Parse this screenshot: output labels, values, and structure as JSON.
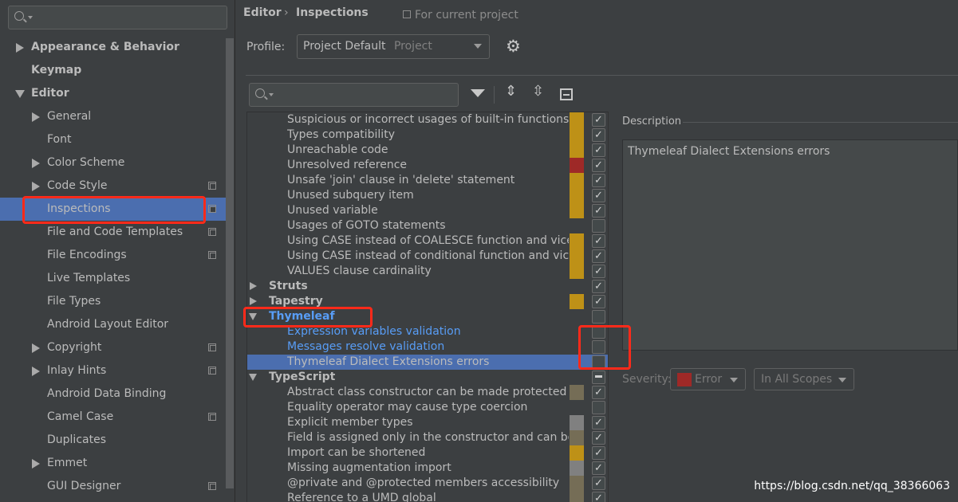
{
  "sidebar": {
    "search_placeholder": "",
    "items": [
      {
        "label": "Appearance & Behavior",
        "level": 0,
        "expander": "collapsed",
        "copy_icon": false
      },
      {
        "label": "Keymap",
        "level": 0,
        "expander": "none",
        "copy_icon": false
      },
      {
        "label": "Editor",
        "level": 0,
        "expander": "expanded",
        "copy_icon": false
      },
      {
        "label": "General",
        "level": 1,
        "expander": "collapsed",
        "copy_icon": false
      },
      {
        "label": "Font",
        "level": 1,
        "expander": "none",
        "copy_icon": false
      },
      {
        "label": "Color Scheme",
        "level": 1,
        "expander": "collapsed",
        "copy_icon": false
      },
      {
        "label": "Code Style",
        "level": 1,
        "expander": "collapsed",
        "copy_icon": true
      },
      {
        "label": "Inspections",
        "level": 1,
        "expander": "none",
        "copy_icon": true,
        "selected": true
      },
      {
        "label": "File and Code Templates",
        "level": 1,
        "expander": "none",
        "copy_icon": true
      },
      {
        "label": "File Encodings",
        "level": 1,
        "expander": "none",
        "copy_icon": true
      },
      {
        "label": "Live Templates",
        "level": 1,
        "expander": "none",
        "copy_icon": false
      },
      {
        "label": "File Types",
        "level": 1,
        "expander": "none",
        "copy_icon": false
      },
      {
        "label": "Android Layout Editor",
        "level": 1,
        "expander": "none",
        "copy_icon": false
      },
      {
        "label": "Copyright",
        "level": 1,
        "expander": "collapsed",
        "copy_icon": true
      },
      {
        "label": "Inlay Hints",
        "level": 1,
        "expander": "collapsed",
        "copy_icon": true
      },
      {
        "label": "Android Data Binding",
        "level": 1,
        "expander": "none",
        "copy_icon": false
      },
      {
        "label": "Camel Case",
        "level": 1,
        "expander": "none",
        "copy_icon": true
      },
      {
        "label": "Duplicates",
        "level": 1,
        "expander": "none",
        "copy_icon": false
      },
      {
        "label": "Emmet",
        "level": 1,
        "expander": "collapsed",
        "copy_icon": false
      },
      {
        "label": "GUI Designer",
        "level": 1,
        "expander": "none",
        "copy_icon": true
      }
    ]
  },
  "header": {
    "breadcrumb": [
      "Editor",
      "Inspections"
    ],
    "breadcrumb_separator": "›",
    "scope_note": "For current project",
    "profile_label": "Profile:",
    "profile_value": "Project Default",
    "profile_type": "Project"
  },
  "colors": {
    "warning": "#be9117",
    "error": "#9e2927",
    "weak_warning": "#756d56",
    "info": "#808080",
    "selection": "#4b6eaf",
    "highlight_text": "#589df6",
    "annotation": "#ff2a1a"
  },
  "inspections": [
    {
      "label": "Suspicious or incorrect usages of built-in functions",
      "type": "c",
      "severity": "warning",
      "checked": "on"
    },
    {
      "label": "Types compatibility",
      "type": "c",
      "severity": "warning",
      "checked": "on"
    },
    {
      "label": "Unreachable code",
      "type": "c",
      "severity": "warning",
      "checked": "on"
    },
    {
      "label": "Unresolved reference",
      "type": "c",
      "severity": "error",
      "checked": "on"
    },
    {
      "label": "Unsafe 'join' clause in 'delete' statement",
      "type": "c",
      "severity": "warning",
      "checked": "on"
    },
    {
      "label": "Unused subquery item",
      "type": "c",
      "severity": "warning",
      "checked": "on"
    },
    {
      "label": "Unused variable",
      "type": "c",
      "severity": "warning",
      "checked": "on"
    },
    {
      "label": "Usages of GOTO statements",
      "type": "c",
      "severity": "",
      "checked": "off"
    },
    {
      "label": "Using CASE instead of COALESCE function and vice versa",
      "type": "c",
      "severity": "warning",
      "checked": "on"
    },
    {
      "label": "Using CASE instead of conditional function and vice versa",
      "type": "c",
      "severity": "warning",
      "checked": "on"
    },
    {
      "label": "VALUES clause cardinality",
      "type": "c",
      "severity": "warning",
      "checked": "on"
    },
    {
      "label": "Struts",
      "type": "g",
      "expander": "collapsed",
      "severity": "",
      "checked": "on"
    },
    {
      "label": "Tapestry",
      "type": "g",
      "expander": "collapsed",
      "severity": "warning",
      "checked": "on"
    },
    {
      "label": "Thymeleaf",
      "type": "g",
      "expander": "expanded",
      "severity": "",
      "checked": "off",
      "highlight": true
    },
    {
      "label": "Expression variables validation",
      "type": "c",
      "severity": "",
      "checked": "off",
      "highlight": true
    },
    {
      "label": "Messages resolve validation",
      "type": "c",
      "severity": "",
      "checked": "off",
      "highlight": true
    },
    {
      "label": "Thymeleaf Dialect Extensions errors",
      "type": "c",
      "severity": "",
      "checked": "off",
      "selected": true
    },
    {
      "label": "TypeScript",
      "type": "g",
      "expander": "expanded",
      "severity": "",
      "checked": "partial"
    },
    {
      "label": "Abstract class constructor can be made protected",
      "type": "c",
      "severity": "weak_warning",
      "checked": "on"
    },
    {
      "label": "Equality operator may cause type coercion",
      "type": "c",
      "severity": "",
      "checked": "off"
    },
    {
      "label": "Explicit member types",
      "type": "c",
      "severity": "info",
      "checked": "on"
    },
    {
      "label": "Field is assigned only in the constructor and can be made readonly",
      "type": "c",
      "severity": "weak_warning",
      "checked": "on"
    },
    {
      "label": "Import can be shortened",
      "type": "c",
      "severity": "warning",
      "checked": "on"
    },
    {
      "label": "Missing augmentation import",
      "type": "c",
      "severity": "info",
      "checked": "on"
    },
    {
      "label": "@private and @protected members accessibility",
      "type": "c",
      "severity": "weak_warning",
      "checked": "on"
    },
    {
      "label": "Reference to a UMD global",
      "type": "c",
      "severity": "weak_warning",
      "checked": "on"
    }
  ],
  "description": {
    "title": "Description",
    "text": "Thymeleaf Dialect Extensions errors",
    "severity_label": "Severity:",
    "severity_value": "Error",
    "scope_value": "In All Scopes"
  },
  "watermark": "https://blog.csdn.net/qq_38366063"
}
